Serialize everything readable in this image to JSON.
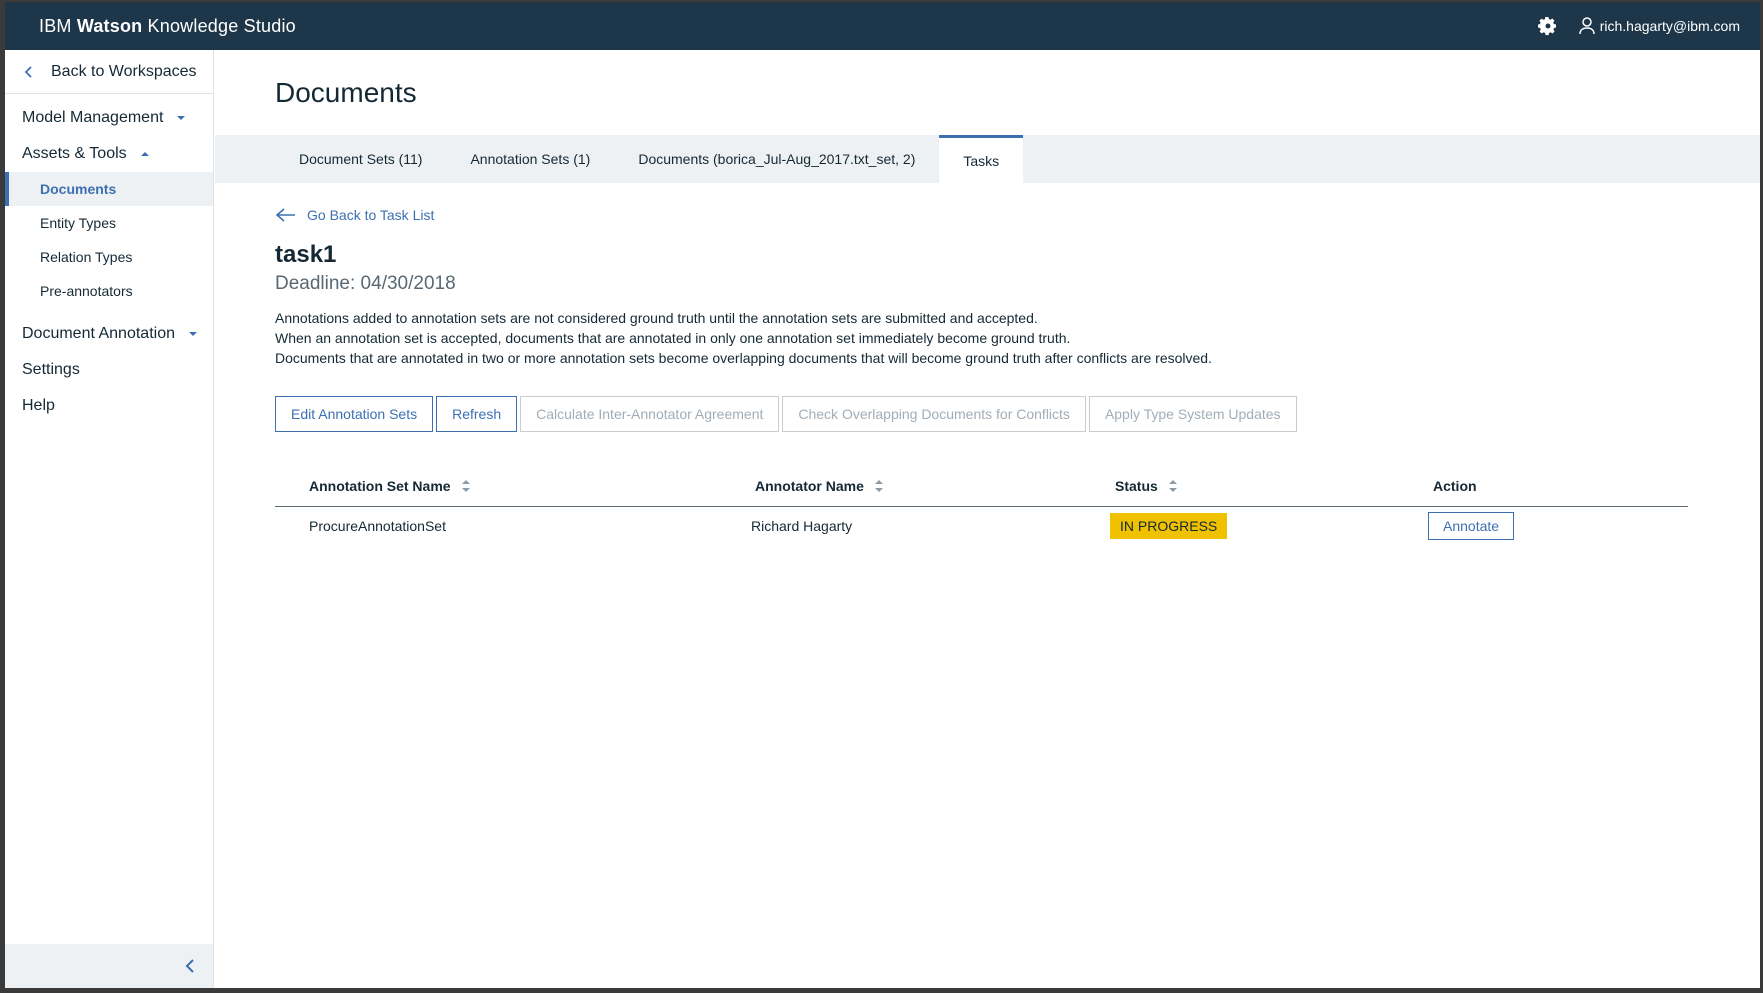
{
  "header": {
    "brand_prefix": "IBM",
    "brand_bold": "Watson",
    "brand_suffix": "Knowledge Studio",
    "user": "rich.hagarty@ibm.com",
    "icons": [
      "gear-icon",
      "user-icon"
    ]
  },
  "sidebar": {
    "back_label": "Back to Workspaces",
    "model_management": "Model Management",
    "assets_tools": "Assets & Tools",
    "sub_items": [
      "Documents",
      "Entity Types",
      "Relation Types",
      "Pre-annotators"
    ],
    "document_annotation": "Document Annotation",
    "settings": "Settings",
    "help": "Help"
  },
  "main": {
    "title": "Documents",
    "tabs": [
      "Document Sets (11)",
      "Annotation Sets (1)",
      "Documents (borica_Jul-Aug_2017.txt_set, 2)",
      "Tasks"
    ],
    "back_link": "Go Back to Task List",
    "task_name": "task1",
    "deadline": "Deadline: 04/30/2018",
    "description": [
      "Annotations added to annotation sets are not considered ground truth until the annotation sets are submitted and accepted.",
      "When an annotation set is accepted, documents that are annotated in only one annotation set immediately become ground truth.",
      "Documents that are annotated in two or more annotation sets become overlapping documents that will become ground truth after conflicts are resolved."
    ],
    "buttons": {
      "edit": "Edit Annotation Sets",
      "refresh": "Refresh",
      "calc": "Calculate Inter-Annotator Agreement",
      "check": "Check Overlapping Documents for Conflicts",
      "apply": "Apply Type System Updates"
    },
    "table": {
      "headers": [
        "Annotation Set Name",
        "Annotator Name",
        "Status",
        "Action"
      ],
      "rows": [
        {
          "set_name": "ProcureAnnotationSet",
          "annotator": "Richard Hagarty",
          "status": "IN PROGRESS",
          "action": "Annotate"
        }
      ]
    }
  },
  "colors": {
    "header_bg": "#1d3649",
    "accent": "#3d70b2",
    "status_in_progress": "#efc100"
  }
}
